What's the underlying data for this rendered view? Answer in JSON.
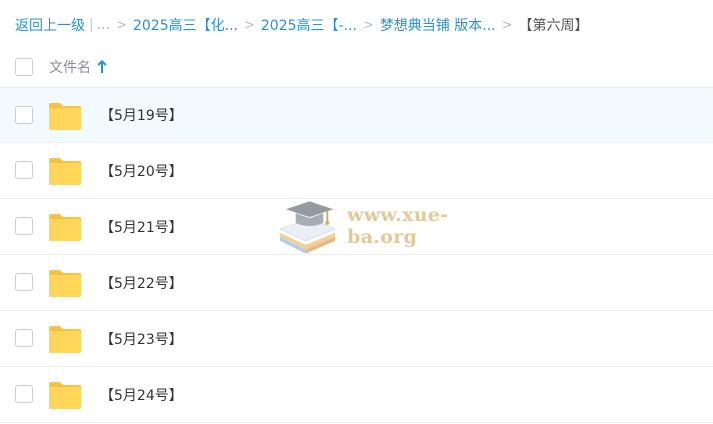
{
  "breadcrumb": {
    "back_label": "返回上一级",
    "ellipsis": "...",
    "items": [
      {
        "label": "2025高三【化..."
      },
      {
        "label": "2025高三【-..."
      },
      {
        "label": "梦想典当铺 版本..."
      }
    ],
    "current": "【第六周】"
  },
  "header": {
    "name_column": "文件名",
    "sort": "ascending"
  },
  "files": [
    {
      "name": "【5月19号】",
      "type": "folder",
      "selected": true
    },
    {
      "name": "【5月20号】",
      "type": "folder",
      "selected": false
    },
    {
      "name": "【5月21号】",
      "type": "folder",
      "selected": false
    },
    {
      "name": "【5月22号】",
      "type": "folder",
      "selected": false
    },
    {
      "name": "【5月23号】",
      "type": "folder",
      "selected": false
    },
    {
      "name": "【5月24号】",
      "type": "folder",
      "selected": false
    }
  ],
  "watermark": {
    "text": "www.xue-ba.org",
    "icon": "graduation-cap-icon"
  },
  "colors": {
    "link": "#2b91d6",
    "folder": "#ffd659",
    "selected_row": "#f2fafe",
    "watermark": "#e0c48e"
  }
}
